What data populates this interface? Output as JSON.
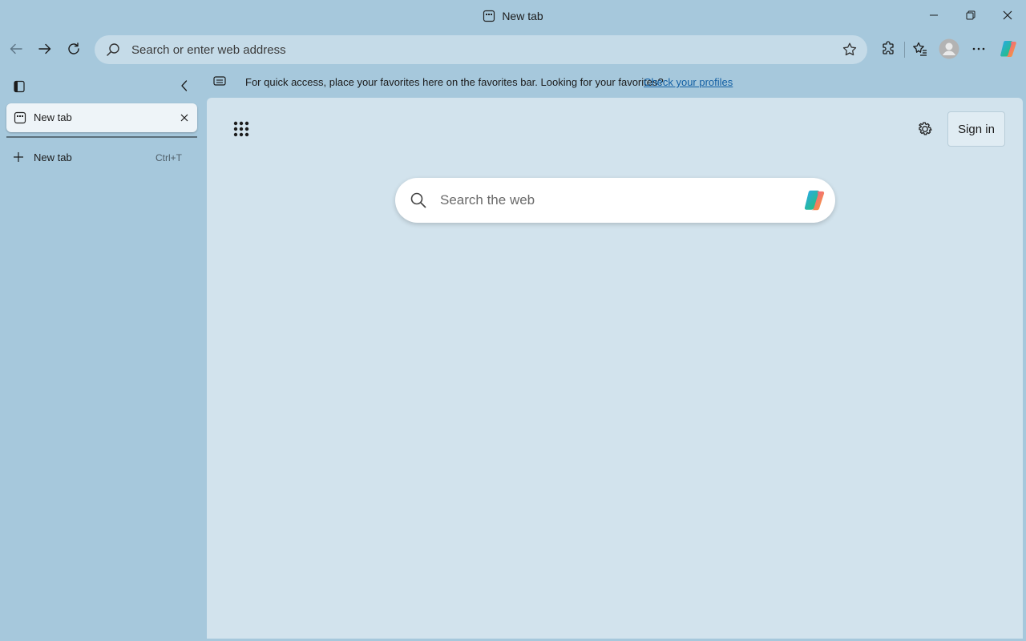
{
  "window": {
    "title": "New tab"
  },
  "toolbar": {
    "address_placeholder": "Search or enter web address"
  },
  "favorites_bar": {
    "message": "For quick access, place your favorites here on the favorites bar. Looking for your favorites?",
    "link": "Check your profiles"
  },
  "sidebar": {
    "active_tab_label": "New tab",
    "new_tab_label": "New tab",
    "new_tab_shortcut": "Ctrl+T"
  },
  "content": {
    "search_placeholder": "Search the web",
    "sign_in_label": "Sign in"
  },
  "icons": {
    "back": "back-arrow-icon",
    "forward": "forward-arrow-icon",
    "refresh": "refresh-icon",
    "apps": "apps-grid-icon",
    "settings": "gear-icon",
    "copilot": "copilot-icon"
  },
  "colors": {
    "frame": "#a6c8dc",
    "content": "#d2e3ed",
    "link": "#115ea3"
  }
}
